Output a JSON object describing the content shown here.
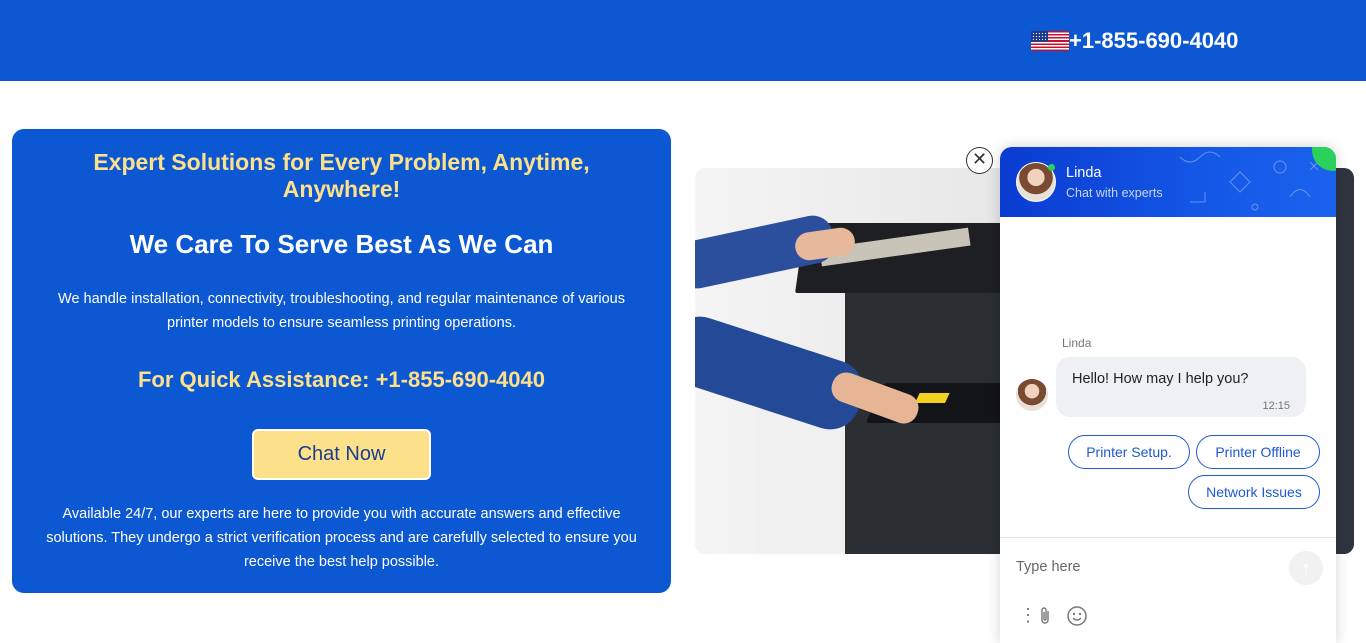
{
  "header": {
    "flag_icon": "us-flag-icon",
    "phone": "+1-855-690-4040",
    "background": "#0c58d3"
  },
  "card": {
    "headline": "Expert Solutions for Every Problem, Anytime, Anywhere!",
    "subhead": "We Care To Serve Best As We Can",
    "description": "We handle installation, connectivity, troubleshooting, and regular maintenance of various printer models to ensure seamless printing operations.",
    "assist": "For Quick Assistance: +1-855-690-4040",
    "chat_button": "Chat Now",
    "availability": "Available 24/7, our experts are here to provide you with accurate answers and effective solutions. They undergo a strict verification process and are carefully selected to ensure you receive the best help possible.",
    "accent": "#fde08a"
  },
  "chat": {
    "close_icon": "close-icon",
    "agent_name": "Linda",
    "agent_subtitle": "Chat with experts",
    "message_sender": "Linda",
    "message_text": "Hello! How may I help you?",
    "message_time": "12:15",
    "quick_replies": [
      "Printer Setup.",
      "Printer Offline",
      "Network Issues"
    ],
    "input_placeholder": "Type here",
    "send_icon": "arrow-up-icon",
    "tools": [
      "more-icon",
      "paperclip-icon",
      "smiley-icon"
    ],
    "online_color": "#2bd15a"
  }
}
